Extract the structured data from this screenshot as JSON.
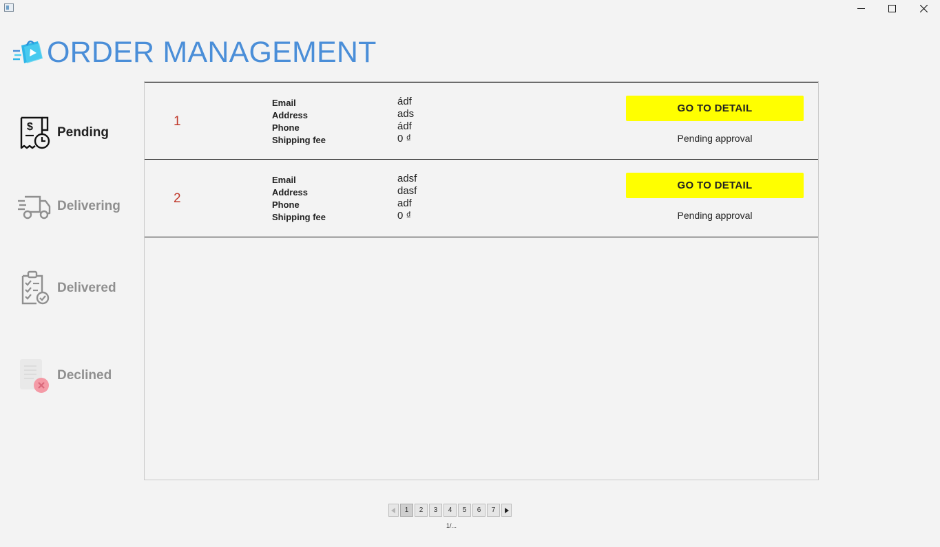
{
  "window": {
    "minimize_icon": "minimize-icon",
    "maximize_icon": "maximize-icon",
    "close_icon": "close-icon"
  },
  "header": {
    "title": "ORDER MANAGEMENT",
    "logo_icon": "shopping-bag-logo-icon",
    "title_color": "#4a8ed8"
  },
  "sidebar": {
    "items": [
      {
        "label": "Pending",
        "icon": "receipt-clock-icon",
        "active": true
      },
      {
        "label": "Delivering",
        "icon": "delivery-truck-icon",
        "active": false
      },
      {
        "label": "Delivered",
        "icon": "clipboard-check-icon",
        "active": false
      },
      {
        "label": "Declined",
        "icon": "document-declined-icon",
        "active": false
      }
    ]
  },
  "orders": {
    "field_labels": [
      "Email",
      "Address",
      "Phone",
      "Shipping fee"
    ],
    "button_label": "GO TO DETAIL",
    "button_color": "#ffff00",
    "index_color": "#c0392b",
    "rows": [
      {
        "index": "1",
        "email": "ádf",
        "address": "ads",
        "phone": "ádf",
        "shipping_fee": "0 ₫",
        "status": "Pending approval"
      },
      {
        "index": "2",
        "email": "adsf",
        "address": "dasf",
        "phone": "adf",
        "shipping_fee": "0 ₫",
        "status": "Pending approval"
      }
    ]
  },
  "pagination": {
    "pages": [
      "1",
      "2",
      "3",
      "4",
      "5",
      "6",
      "7"
    ],
    "current": "1",
    "prev_icon": "triangle-left-icon",
    "next_icon": "triangle-right-icon",
    "page_count": "1/..."
  }
}
